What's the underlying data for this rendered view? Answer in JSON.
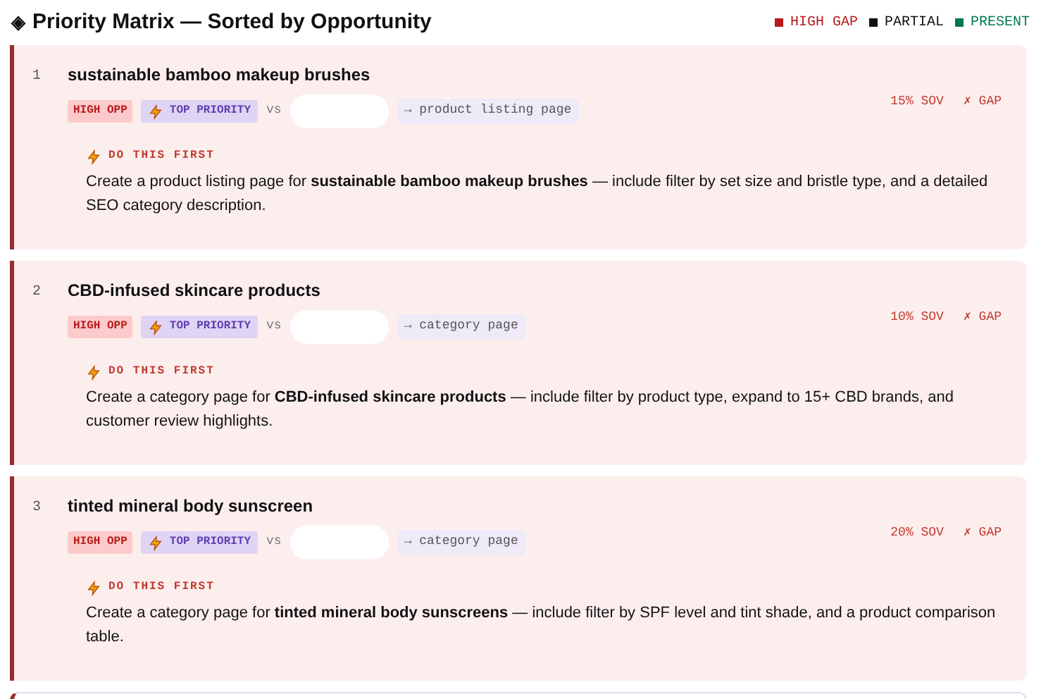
{
  "header": {
    "icon": "◈",
    "title": "Priority Matrix — Sorted by Opportunity",
    "legend": [
      {
        "label": "HIGH GAP",
        "color": "#b91c1c"
      },
      {
        "label": "PARTIAL",
        "color": "#111111"
      },
      {
        "label": "PRESENT",
        "color": "#047857"
      }
    ]
  },
  "items": [
    {
      "rank": "1",
      "title": "sustainable bamboo makeup brushes",
      "opportunity": "HIGH OPP",
      "priority": "TOP PRIORITY",
      "vs": "vs",
      "target": "→ product listing page",
      "sov": "15% SOV",
      "gap": "✗ GAP",
      "action_label": "DO THIS FIRST",
      "action": "Create a product listing page for **sustainable bamboo makeup brushes** — include filter by set size and bristle type, and a detailed SEO category description."
    },
    {
      "rank": "2",
      "title": "CBD-infused skincare products",
      "opportunity": "HIGH OPP",
      "priority": "TOP PRIORITY",
      "vs": "vs",
      "target": "→ category page",
      "sov": "10% SOV",
      "gap": "✗ GAP",
      "action_label": "DO THIS FIRST",
      "action": "Create a category page for **CBD-infused skincare products** — include filter by product type, expand to 15+ CBD brands, and customer review highlights."
    },
    {
      "rank": "3",
      "title": "tinted mineral body sunscreen",
      "opportunity": "HIGH OPP",
      "priority": "TOP PRIORITY",
      "vs": "vs",
      "target": "→ category page",
      "sov": "20% SOV",
      "gap": "✗ GAP",
      "action_label": "DO THIS FIRST",
      "action": "Create a category page for **tinted mineral body sunscreens** — include filter by SPF level and tint shade, and a product comparison table."
    }
  ]
}
